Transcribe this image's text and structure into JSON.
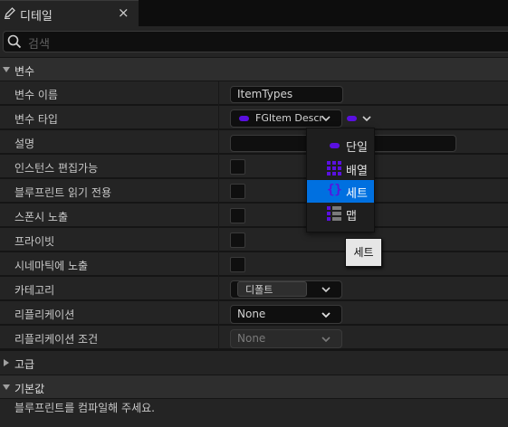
{
  "tab": {
    "title": "디테일",
    "close": "×"
  },
  "search": {
    "placeholder": "검색"
  },
  "sections": {
    "variable": "변수",
    "advanced": "고급",
    "default_value": "기본값"
  },
  "properties": {
    "name_label": "변수 이름",
    "name_value": "ItemTypes",
    "type_label": "변수 타입",
    "type_value": "FGItem Descr",
    "description_label": "설명",
    "instance_editable_label": "인스턴스 편집가능",
    "blueprint_readonly_label": "블루프린트 읽기 전용",
    "expose_spawn_label": "스폰시 노출",
    "private_label": "프라이빗",
    "expose_cinematic_label": "시네마틱에 노출",
    "category_label": "카테고리",
    "category_value": "디폴트",
    "replication_label": "리플리케이션",
    "replication_value": "None",
    "replication_condition_label": "리플리케이션 조건",
    "replication_condition_value": "None"
  },
  "container_menu": {
    "items": [
      {
        "label": "단일",
        "icon": "single-pill-icon"
      },
      {
        "label": "배열",
        "icon": "array-grid-icon"
      },
      {
        "label": "세트",
        "icon": "set-braces-icon",
        "selected": true
      },
      {
        "label": "맵",
        "icon": "map-list-icon"
      }
    ]
  },
  "tooltip": "세트",
  "default_value_message": "블루프린트를 컴파일해 주세요.",
  "colors": {
    "accent": "#0070e0",
    "type_purple": "#5a10e0",
    "panel": "#242424",
    "header": "#2e2e2e"
  }
}
